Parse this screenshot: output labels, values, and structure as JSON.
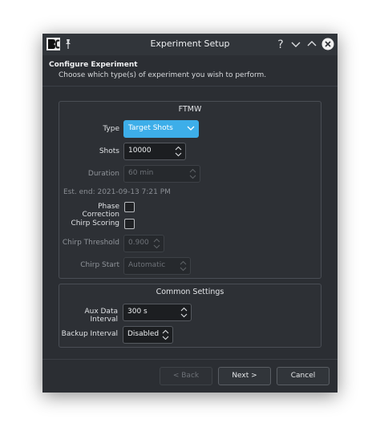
{
  "window": {
    "title": "Experiment Setup",
    "help_glyph": "?"
  },
  "header": {
    "title": "Configure Experiment",
    "subtitle": "Choose which type(s) of experiment you wish to perform."
  },
  "ftmw": {
    "title": "FTMW",
    "type_label": "Type",
    "type_value": "Target Shots",
    "shots_label": "Shots",
    "shots_value": "10000",
    "duration_label": "Duration",
    "duration_value": "60 min",
    "est_end": "Est. end: 2021-09-13 7:21 PM",
    "phase_correction_label": "Phase Correction",
    "chirp_scoring_label": "Chirp Scoring",
    "chirp_threshold_label": "Chirp Threshold",
    "chirp_threshold_value": "0.900",
    "chirp_start_label": "Chirp Start",
    "chirp_start_value": "Automatic"
  },
  "common": {
    "title": "Common Settings",
    "aux_label": "Aux Data Interval",
    "aux_value": "300 s",
    "backup_label": "Backup Interval",
    "backup_value": "Disabled"
  },
  "buttons": {
    "back": "< Back",
    "next": "Next >",
    "cancel": "Cancel"
  },
  "colors": {
    "accent": "#3daee9",
    "window_bg": "#2b2e33"
  }
}
